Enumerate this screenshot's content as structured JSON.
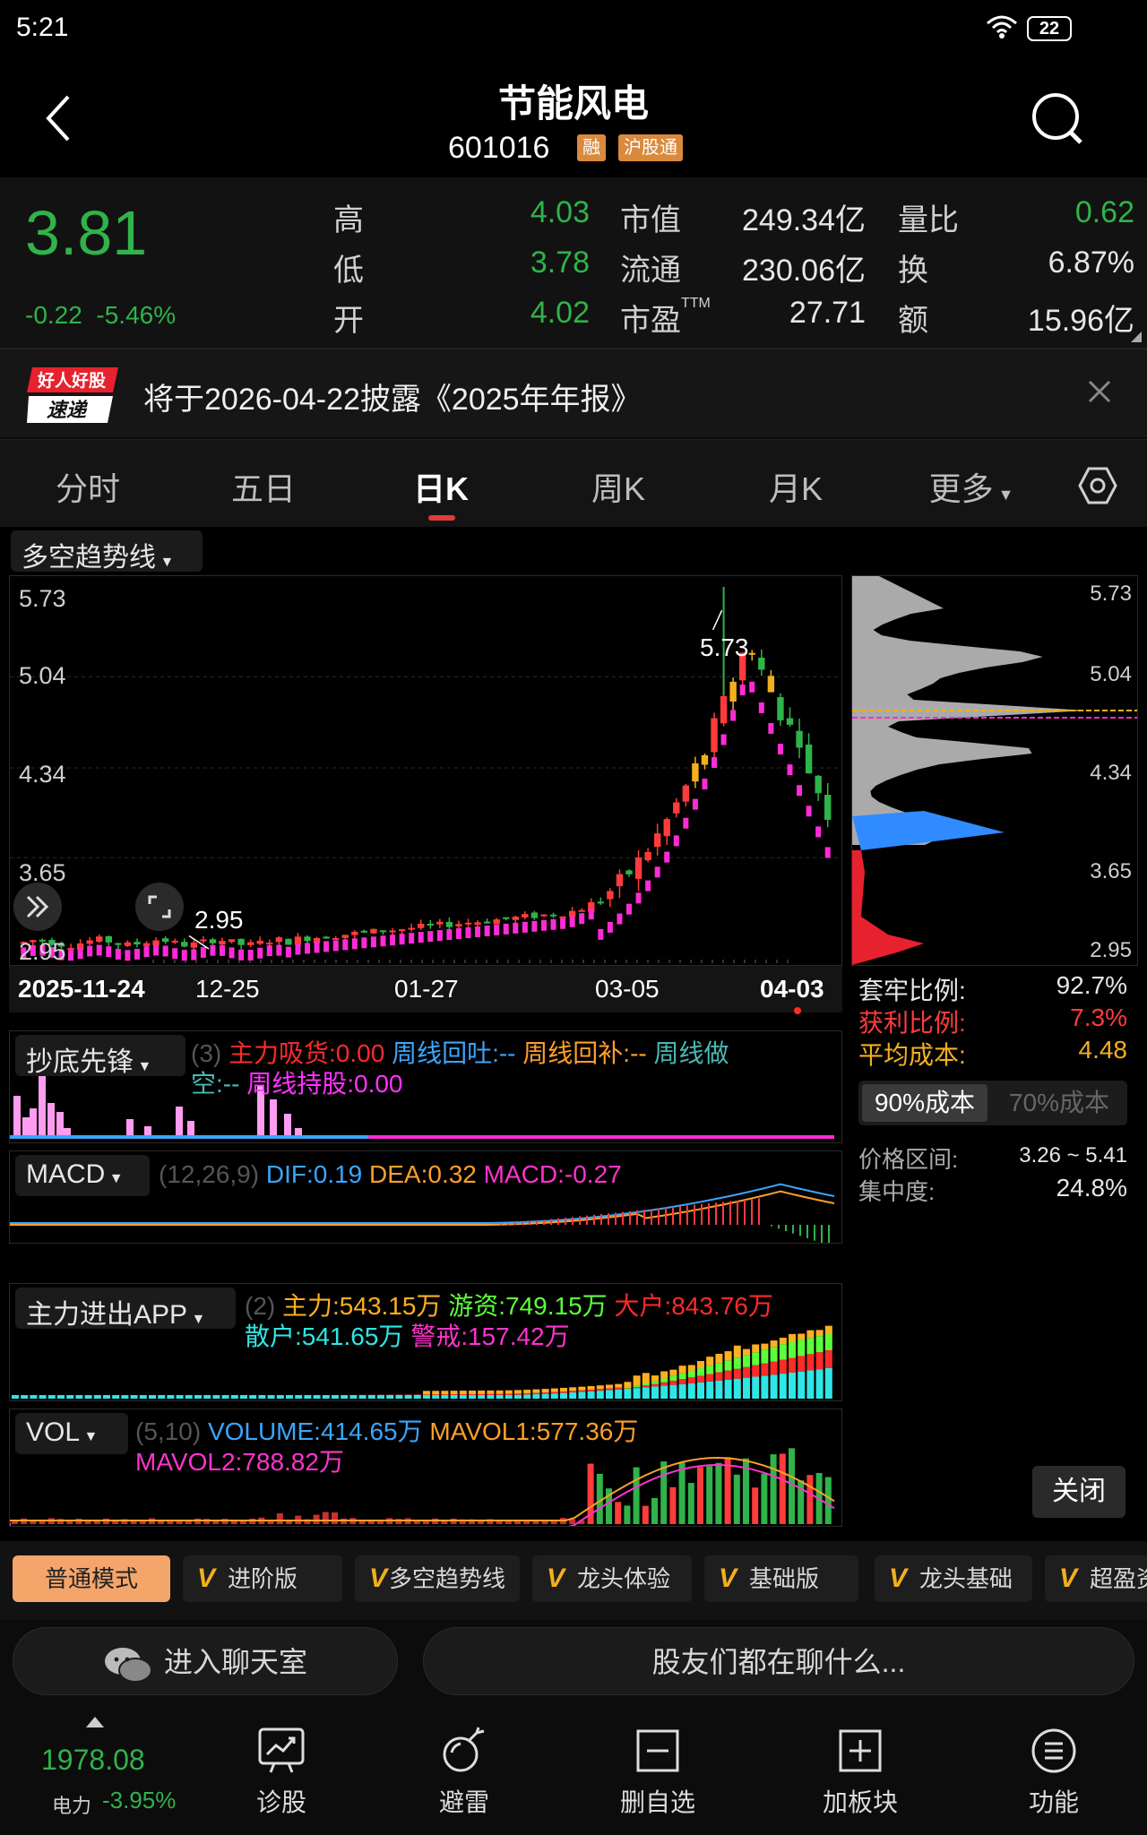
{
  "status_bar": {
    "time": "5:21",
    "battery": "22"
  },
  "header": {
    "name": "节能风电",
    "code": "601016",
    "tags": [
      "融",
      "沪股通"
    ]
  },
  "quote": {
    "price": "3.81",
    "change": "-0.22",
    "change_pct": "-5.46%",
    "rows": [
      [
        {
          "l": "高",
          "v": "4.03",
          "c": "#2fb34a"
        },
        {
          "l": "市值",
          "v": "249.34亿",
          "c": "#e6e6e6"
        },
        {
          "l": "量比",
          "v": "0.62",
          "c": "#2fb34a"
        }
      ],
      [
        {
          "l": "低",
          "v": "3.78",
          "c": "#2fb34a"
        },
        {
          "l": "流通",
          "v": "230.06亿",
          "c": "#e6e6e6"
        },
        {
          "l": "换",
          "v": "6.87%",
          "c": "#e6e6e6"
        }
      ],
      [
        {
          "l": "开",
          "v": "4.02",
          "c": "#2fb34a"
        },
        {
          "l": "市盈",
          "sup": "TTM",
          "v": "27.71",
          "c": "#e6e6e6"
        },
        {
          "l": "额",
          "v": "15.96亿",
          "c": "#e6e6e6"
        }
      ]
    ]
  },
  "notice": {
    "logo_top": "好人好股",
    "logo_bottom": "速递",
    "text": "将于2026-04-22披露《2025年年报》"
  },
  "tabs": [
    "分时",
    "五日",
    "日K",
    "周K",
    "月K",
    "更多"
  ],
  "active_tab": 2,
  "kline": {
    "indicator_label": "多空趋势线",
    "y_ticks": [
      "5.73",
      "5.04",
      "4.34",
      "3.65",
      "2.95"
    ],
    "x_ticks": [
      "2025-11-24",
      "12-25",
      "01-27",
      "03-05",
      "04-03"
    ],
    "high_label": "5.73",
    "low_label": "2.95"
  },
  "chip": {
    "y_ticks": [
      "5.73",
      "5.04",
      "4.34",
      "3.65",
      "2.95"
    ],
    "rows": [
      {
        "l": "套牢比例:",
        "v": "92.7%",
        "lc": "#e6e6e6",
        "vc": "#e6e6e6"
      },
      {
        "l": "获利比例:",
        "v": "7.3%",
        "lc": "#ff3b3b",
        "vc": "#ff3b3b"
      },
      {
        "l": "平均成本:",
        "v": "4.48",
        "lc": "#f2b01e",
        "vc": "#f2b01e"
      }
    ],
    "tab_active": "90%成本",
    "tab_other": "70%成本",
    "range_label": "价格区间:",
    "range_value": "3.26 ~ 5.41",
    "conc_label": "集中度:",
    "conc_value": "24.8%",
    "close_label": "关闭"
  },
  "ind1": {
    "dropdown": "抄底先锋",
    "param": "(3)",
    "line1": [
      {
        "t": "主力吸货:0.00",
        "c": "#ff2a2a"
      },
      {
        "t": "周线回吐:--",
        "c": "#3aa6ff"
      },
      {
        "t": "周线回补:--",
        "c": "#ff9f2a"
      },
      {
        "t": "周线做",
        "c": "#48b9b3"
      }
    ],
    "line2": [
      {
        "t": "空:--",
        "c": "#48b9b3"
      },
      {
        "t": "周线持股:0.00",
        "c": "#ff33ff"
      }
    ]
  },
  "macd": {
    "dropdown": "MACD",
    "param": "(12,26,9)",
    "items": [
      {
        "t": "DIF:0.19",
        "c": "#3aa6ff"
      },
      {
        "t": "DEA:0.32",
        "c": "#ff9f2a"
      },
      {
        "t": "MACD:-0.27",
        "c": "#ff33cc"
      }
    ]
  },
  "zljc": {
    "dropdown": "主力进出APP",
    "param": "(2)",
    "line1": [
      {
        "t": "主力:543.15万",
        "c": "#ffb020"
      },
      {
        "t": "游资:749.15万",
        "c": "#5cff3a"
      },
      {
        "t": "大户:843.76万",
        "c": "#ff2a2a"
      }
    ],
    "line2": [
      {
        "t": "散户:541.65万",
        "c": "#2ee6e6"
      },
      {
        "t": "警戒:157.42万",
        "c": "#ff33cc"
      }
    ]
  },
  "vol": {
    "dropdown": "VOL",
    "param": "(5,10)",
    "line1": [
      {
        "t": "VOLUME:414.65万",
        "c": "#3aa6ff"
      },
      {
        "t": "MAVOL1:577.36万",
        "c": "#ff9f2a"
      }
    ],
    "line2": [
      {
        "t": "MAVOL2:788.82万",
        "c": "#ff33cc"
      }
    ]
  },
  "modes": [
    "普通模式",
    "进阶版",
    "多空趋势线",
    "龙头体验",
    "基础版",
    "龙头基础",
    "超盈资"
  ],
  "chat": {
    "enter": "进入聊天室",
    "topic": "股友们都在聊什么..."
  },
  "bottom_nav": {
    "index_value": "1978.08",
    "index_name": "电力",
    "index_change": "-3.95%",
    "items": [
      "诊股",
      "避雷",
      "删自选",
      "加板块",
      "功能"
    ]
  },
  "colors": {
    "up": "#ff3b3b",
    "down": "#2fb34a",
    "accent": "#f2b01e",
    "magenta": "#ff2bd6"
  }
}
